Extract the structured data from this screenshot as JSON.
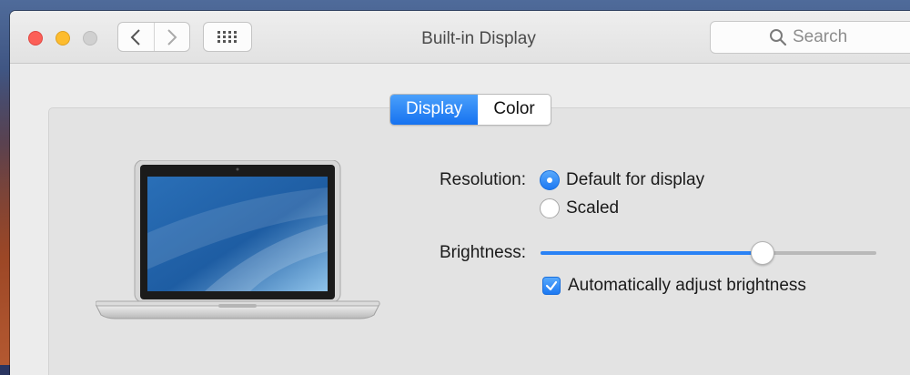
{
  "window": {
    "title": "Built-in Display"
  },
  "toolbar": {
    "back_icon": "chevron-left-icon",
    "forward_icon": "chevron-right-icon",
    "show_all_icon": "grid-icon",
    "search_placeholder": "Search"
  },
  "tabs": [
    {
      "label": "Display",
      "active": true
    },
    {
      "label": "Color",
      "active": false
    }
  ],
  "display": {
    "resolution_label": "Resolution:",
    "resolution_options": [
      {
        "label": "Default for display",
        "selected": true
      },
      {
        "label": "Scaled",
        "selected": false
      }
    ],
    "brightness_label": "Brightness:",
    "brightness_level": 0.66,
    "auto_brightness_label": "Automatically adjust brightness",
    "auto_brightness_checked": true
  },
  "colors": {
    "accent": "#1c78f2",
    "close": "#fc5f57",
    "minimize": "#fdbc2e"
  }
}
